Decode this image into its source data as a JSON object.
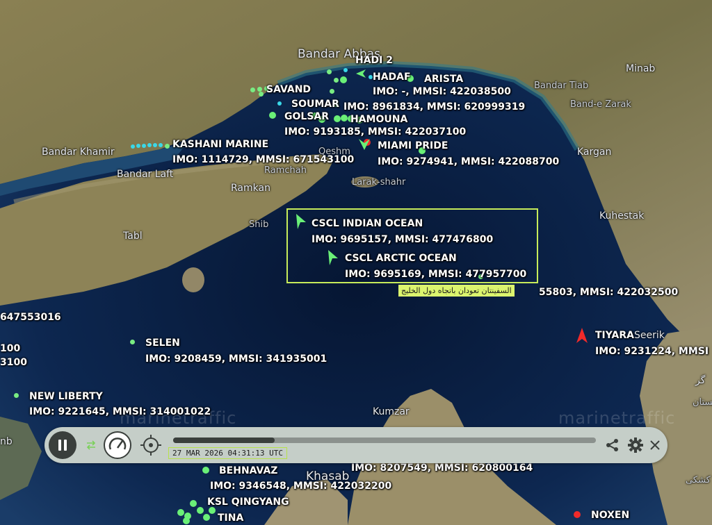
{
  "map": {
    "places": [
      {
        "key": "bandar_abbas",
        "label": "Bandar Abbas"
      },
      {
        "key": "minab",
        "label": "Minab"
      },
      {
        "key": "bandar_tiab",
        "label": "Bandar Tiab"
      },
      {
        "key": "band_e_zarak",
        "label": "Band-e Zarak"
      },
      {
        "key": "bandar_khamir",
        "label": "Bandar Khamir"
      },
      {
        "key": "bandar_laft",
        "label": "Bandar Laft"
      },
      {
        "key": "qeshm",
        "label": "Qeshm"
      },
      {
        "key": "ramchah",
        "label": "Ramchah"
      },
      {
        "key": "ramkan",
        "label": "Ramkan"
      },
      {
        "key": "larak",
        "label": "Larak-shahr"
      },
      {
        "key": "kargan",
        "label": "Kargan"
      },
      {
        "key": "kuhestak",
        "label": "Kuhestak"
      },
      {
        "key": "tabl",
        "label": "Tabl"
      },
      {
        "key": "shib",
        "label": "Shib"
      },
      {
        "key": "seerik",
        "label": "Seerik"
      },
      {
        "key": "kumzar",
        "label": "Kumzar"
      },
      {
        "key": "khasab",
        "label": "Khasab"
      },
      {
        "key": "gar",
        "label": "گر"
      },
      {
        "key": "kuhestan",
        "label": "کوهستان"
      },
      {
        "key": "kashki",
        "label": "کشکی"
      },
      {
        "key": "nb",
        "label": "nb"
      }
    ],
    "watermarks": [
      "marinetraffic",
      "marinetraffic"
    ]
  },
  "vessels": [
    {
      "key": "hadi2",
      "name": "HADI 2",
      "info": ""
    },
    {
      "key": "hadaf",
      "name": "HADAF",
      "info": "IMO: -, MMSI: 422038500"
    },
    {
      "key": "arista",
      "name": "ARISTA",
      "info": ""
    },
    {
      "key": "savand",
      "name": "SAVAND",
      "info": ""
    },
    {
      "key": "soumar",
      "name": "SOUMAR",
      "info": "IMO: 8961834, MMSI: 620999319"
    },
    {
      "key": "golsar",
      "name": "GOLSAR",
      "info": ""
    },
    {
      "key": "hamouna",
      "name": "HAMOUNA",
      "info": "IMO: 9193185, MMSI: 422037100"
    },
    {
      "key": "kashani",
      "name": "KASHANI MARINE",
      "info": "IMO: 1114729, MMSI: 671543100"
    },
    {
      "key": "miami",
      "name": "MIAMI PRIDE",
      "info": "IMO: 9274941, MMSI: 422088700"
    },
    {
      "key": "indian",
      "name": "CSCL INDIAN OCEAN",
      "info": "IMO: 9695157, MMSI: 477476800"
    },
    {
      "key": "arctic",
      "name": "CSCL ARCTIC OCEAN",
      "info": "IMO: 9695169, MMSI: 477957700"
    },
    {
      "key": "partial1",
      "name": "",
      "info": "55803, MMSI: 422032500"
    },
    {
      "key": "tiyara",
      "name": "TIYARA",
      "info": "IMO: 9231224, MMSI"
    },
    {
      "key": "selen",
      "name": "SELEN",
      "info": "IMO: 9208459, MMSI: 341935001"
    },
    {
      "key": "newliberty",
      "name": "NEW LIBERTY",
      "info": "IMO: 9221645, MMSI: 314001022"
    },
    {
      "key": "behnavaz",
      "name": "BEHNAVAZ",
      "info": "IMO: 9346548, MMSI: 422032200"
    },
    {
      "key": "partial2",
      "name": "",
      "info": "IMO: 8207549, MMSI: 620800164"
    },
    {
      "key": "ksl",
      "name": "KSL QINGYANG",
      "info": ""
    },
    {
      "key": "tina",
      "name": "TINA",
      "info": ""
    },
    {
      "key": "noxen",
      "name": "NOXEN",
      "info": ""
    },
    {
      "key": "leftcut1",
      "name": "",
      "info": "647553016"
    },
    {
      "key": "leftcut2",
      "name": "",
      "info": "100"
    },
    {
      "key": "leftcut3",
      "name": "",
      "info": "3100"
    }
  ],
  "tooltip": "السفينتان تعودان باتجاه دول الخليج",
  "player": {
    "timestamp": "27 MAR 2026 04:31:13 UTC",
    "progress": 0.24,
    "icons": [
      "pause-icon",
      "swap-arrows-icon",
      "speed-gauge-icon",
      "crosshair-icon",
      "share-icon",
      "gear-icon",
      "close-icon"
    ]
  },
  "colors": {
    "vessel_green": "#6af077",
    "vessel_red": "#f02a2a",
    "selection": "#c7ec5a",
    "sea": "#0b2147"
  }
}
